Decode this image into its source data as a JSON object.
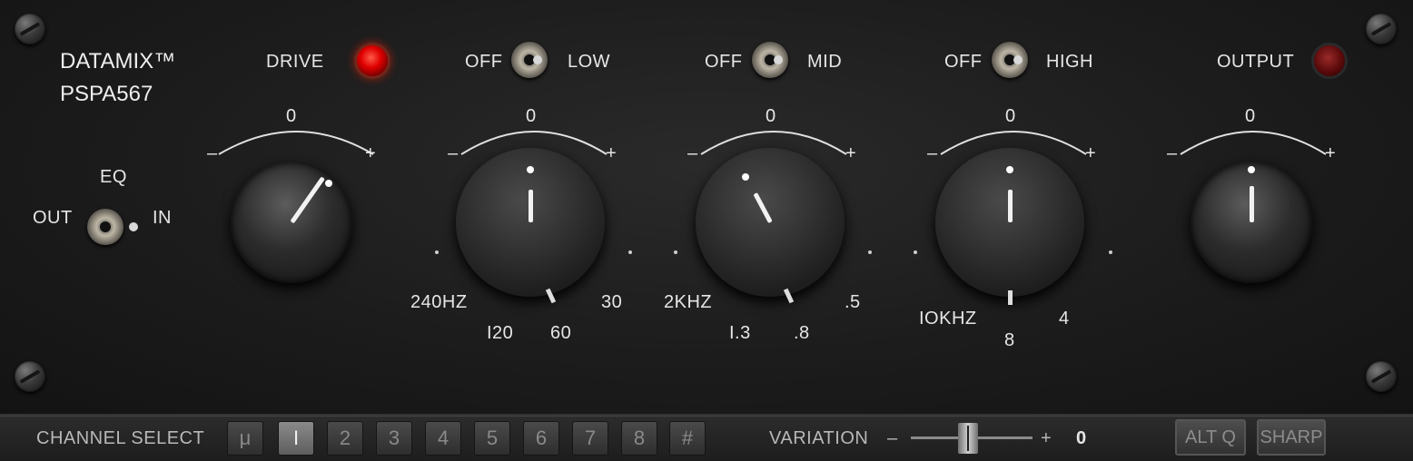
{
  "brand": {
    "line1": "DATAMIX™",
    "line2": "PSPA567"
  },
  "eq_switch": {
    "title": "EQ",
    "off_label": "OUT",
    "on_label": "IN",
    "state": "in"
  },
  "drive": {
    "label": "DRIVE",
    "led_on": true,
    "scale": {
      "zero": "0",
      "minus": "–",
      "plus": "+"
    },
    "value_deg": 35
  },
  "low": {
    "toggle_off": "OFF",
    "toggle_on": "LOW",
    "state": "off",
    "scale": {
      "zero": "0",
      "minus": "–",
      "plus": "+"
    },
    "gain_deg": 0,
    "freqs": [
      "240HZ",
      "I20",
      "60",
      "30"
    ],
    "selected_freq": "60"
  },
  "mid": {
    "toggle_off": "OFF",
    "toggle_on": "MID",
    "state": "off",
    "scale": {
      "zero": "0",
      "minus": "–",
      "plus": "+"
    },
    "gain_deg": -28,
    "freqs": [
      "2KHZ",
      "I.3",
      ".8",
      ".5"
    ],
    "selected_freq": ".8"
  },
  "high": {
    "toggle_off": "OFF",
    "toggle_on": "HIGH",
    "state": "off",
    "scale": {
      "zero": "0",
      "minus": "–",
      "plus": "+"
    },
    "gain_deg": 0,
    "freqs": [
      "IOKHZ",
      "8",
      "4"
    ],
    "selected_freq": "8"
  },
  "output": {
    "label": "OUTPUT",
    "led_on": false,
    "scale": {
      "zero": "0",
      "minus": "–",
      "plus": "+"
    },
    "value_deg": 0
  },
  "bottom": {
    "channel_select_label": "CHANNEL SELECT",
    "channels": [
      "μ",
      "I",
      "2",
      "3",
      "4",
      "5",
      "6",
      "7",
      "8",
      "#"
    ],
    "active_channel": "I",
    "variation_label": "VARIATION",
    "variation_minus": "–",
    "variation_plus": "+",
    "variation_value": "0",
    "alt_q": "ALT Q",
    "sharp": "SHARP"
  }
}
